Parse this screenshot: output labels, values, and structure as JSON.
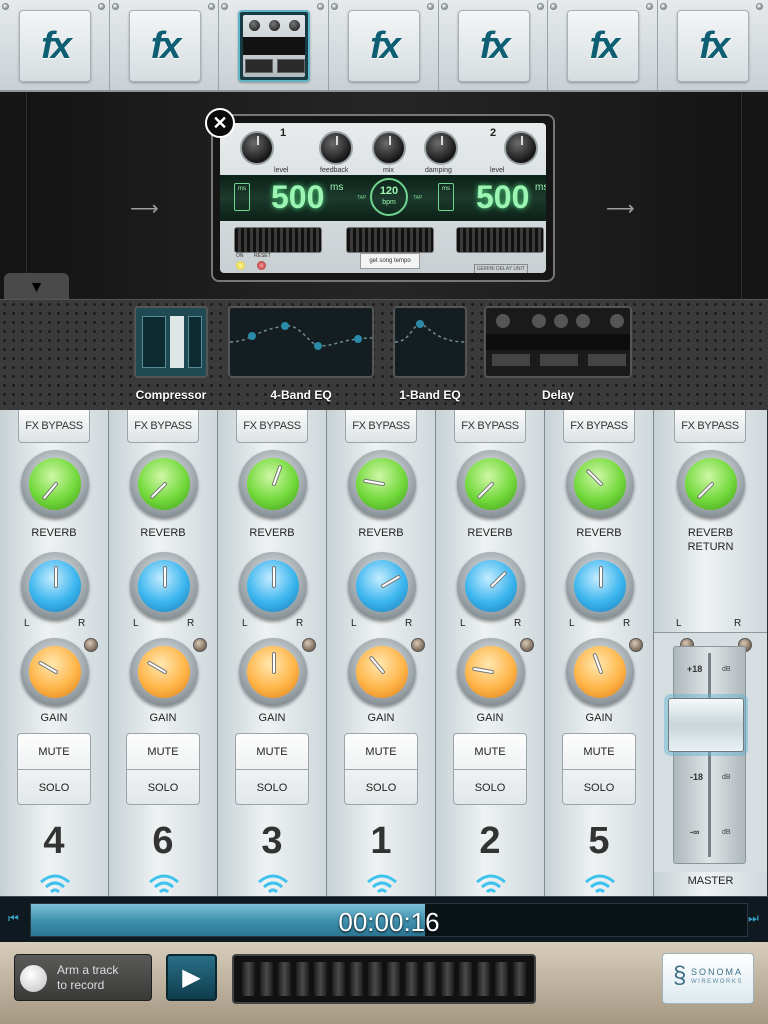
{
  "fx_slots": [
    {
      "label": "fx",
      "active": false
    },
    {
      "label": "fx",
      "active": false
    },
    {
      "label": "delay",
      "active": true
    },
    {
      "label": "fx",
      "active": false
    },
    {
      "label": "fx",
      "active": false
    },
    {
      "label": "fx",
      "active": false
    },
    {
      "label": "fx",
      "active": false
    }
  ],
  "delay_unit": {
    "close_label": "✕",
    "ch1_num": "1",
    "ch2_num": "2",
    "knob_labels": [
      "level",
      "feedback",
      "mix",
      "damping",
      "level"
    ],
    "left_ms": "500",
    "right_ms": "500",
    "ms_unit": "ms",
    "box_label": "ms",
    "bpm_value": "120",
    "bpm_unit": "bpm",
    "tap": "TAP",
    "on_label": "ON",
    "reset_label": "RESET",
    "song_tempo": "get song tempo",
    "brand": "GEMINI",
    "brand_model": "DELAY UNIT"
  },
  "tray": {
    "collapse_icon": "▼",
    "items": [
      {
        "label": "Compressor"
      },
      {
        "label": "4-Band EQ"
      },
      {
        "label": "1-Band EQ"
      },
      {
        "label": "Delay"
      }
    ]
  },
  "channels": [
    {
      "number": "4",
      "bypass": "FX BYPASS",
      "reverb": "REVERB",
      "gain": "GAIN",
      "mute": "MUTE",
      "solo": "SOLO",
      "L": "L",
      "R": "R"
    },
    {
      "number": "6",
      "bypass": "FX BYPASS",
      "reverb": "REVERB",
      "gain": "GAIN",
      "mute": "MUTE",
      "solo": "SOLO",
      "L": "L",
      "R": "R"
    },
    {
      "number": "3",
      "bypass": "FX BYPASS",
      "reverb": "REVERB",
      "gain": "GAIN",
      "mute": "MUTE",
      "solo": "SOLO",
      "L": "L",
      "R": "R"
    },
    {
      "number": "1",
      "bypass": "FX BYPASS",
      "reverb": "REVERB",
      "gain": "GAIN",
      "mute": "MUTE",
      "solo": "SOLO",
      "L": "L",
      "R": "R"
    },
    {
      "number": "2",
      "bypass": "FX BYPASS",
      "reverb": "REVERB",
      "gain": "GAIN",
      "mute": "MUTE",
      "solo": "SOLO",
      "L": "L",
      "R": "R"
    },
    {
      "number": "5",
      "bypass": "FX BYPASS",
      "reverb": "REVERB",
      "gain": "GAIN",
      "mute": "MUTE",
      "solo": "SOLO",
      "L": "L",
      "R": "R"
    }
  ],
  "master": {
    "bypass": "FX BYPASS",
    "reverb_return_1": "REVERB",
    "reverb_return_2": "RETURN",
    "L": "L",
    "R": "R",
    "scale": [
      "+18",
      "0",
      "-18",
      "-∞"
    ],
    "db": "dB",
    "label": "MASTER"
  },
  "transport": {
    "time": "00:00:16",
    "progress_percent": 55,
    "arm_line1": "Arm a track",
    "arm_line2": "to record",
    "play_icon": "▶",
    "logo_main": "SONOMA",
    "logo_sub": "WIREWORKS"
  },
  "colors": {
    "accent": "#0e5f74",
    "reverb": "#72d93b",
    "pan": "#3bb5ee",
    "gain": "#ffb549",
    "display": "#9cf5b3"
  }
}
